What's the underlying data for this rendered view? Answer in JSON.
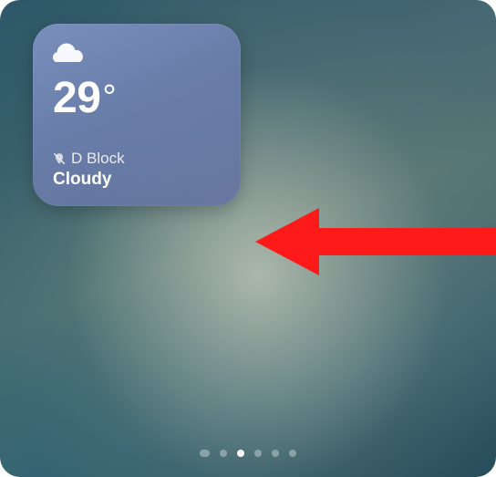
{
  "weather_widget": {
    "temperature_value": "29",
    "temperature_unit": "°",
    "location": "D Block",
    "condition": "Cloudy",
    "icon": "cloud"
  },
  "annotation": {
    "arrow_color": "#ff1a1a"
  },
  "pagination": {
    "total_pages": 6,
    "active_index": 2,
    "has_search_page": true
  }
}
